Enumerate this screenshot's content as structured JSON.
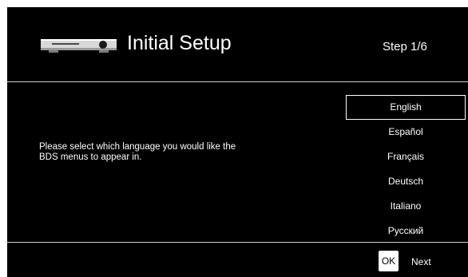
{
  "header": {
    "icon": "blu-ray-player-icon",
    "title": "Initial Setup",
    "step": "Step 1/6"
  },
  "prompt": {
    "line1": "Please select which language you would like the",
    "line2": "BDS menus to appear in."
  },
  "languages": {
    "selected": "English",
    "items": [
      "English",
      "Español",
      "Français",
      "Deutsch",
      "Italiano",
      "Русский"
    ]
  },
  "footer": {
    "ok_label": "OK",
    "next_label": "Next"
  },
  "colors": {
    "background": "#000000",
    "text": "#ffffff",
    "divider": "#cfcfcf"
  }
}
